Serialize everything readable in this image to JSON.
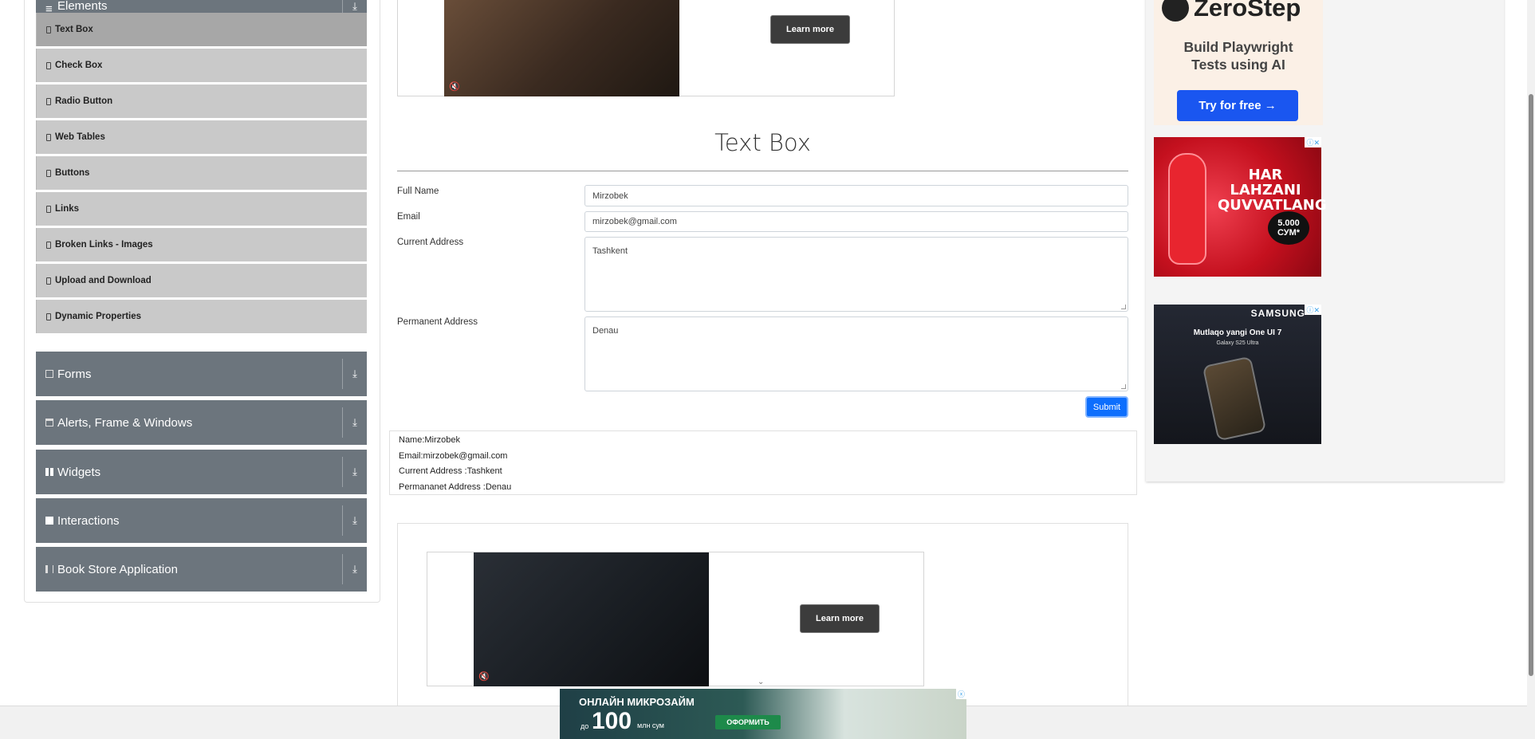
{
  "sidebar": {
    "elements_header": "Elements",
    "items": [
      {
        "label": "Text Box"
      },
      {
        "label": "Check Box"
      },
      {
        "label": "Radio Button"
      },
      {
        "label": "Web Tables"
      },
      {
        "label": "Buttons"
      },
      {
        "label": "Links"
      },
      {
        "label": "Broken Links - Images"
      },
      {
        "label": "Upload and Download"
      },
      {
        "label": "Dynamic Properties"
      }
    ],
    "groups": [
      {
        "label": "Forms",
        "icon": "form-icon"
      },
      {
        "label": "Alerts, Frame & Windows",
        "icon": "window-icon"
      },
      {
        "label": "Widgets",
        "icon": "widgets-icon"
      },
      {
        "label": "Interactions",
        "icon": "interactions-icon"
      },
      {
        "label": "Book Store Application",
        "icon": "book-icon"
      }
    ],
    "expand_arrow": "⤓"
  },
  "top_ad": {
    "button": "Learn more",
    "mute": "🔇"
  },
  "main": {
    "title": "Text Box",
    "fields": {
      "full_name_label": "Full Name",
      "full_name_value": "Mirzobek",
      "email_label": "Email",
      "email_value": "mirzobek@gmail.com",
      "current_address_label": "Current Address",
      "current_address_value": "Tashkent",
      "permanent_address_label": "Permanent Address",
      "permanent_address_value": "Denau"
    },
    "submit_label": "Submit",
    "output": {
      "name": "Name:Mirzobek",
      "email": "Email:mirzobek@gmail.com",
      "current_address": "Current Address :Tashkent",
      "permanent_address": "Permananet Address :Denau"
    }
  },
  "bottom_ad": {
    "button": "Learn more",
    "mute": "🔇",
    "chevron": "⌄"
  },
  "right_ads": {
    "zerostep": {
      "brand": "ZeroStep",
      "line1": "Build Playwright",
      "line2": "Tests using AI",
      "button": "Try for free →"
    },
    "red": {
      "line1": "HAR",
      "line2": "LAHZANI",
      "line3": "QUVVATLANG",
      "price": "5.000",
      "currency": "СУМ*"
    },
    "samsung": {
      "brand": "SAMSUNG",
      "line1": "Mutlaqo yangi One UI 7",
      "line2": "Galaxy S25 Ultra"
    }
  },
  "banner": {
    "title": "ОНЛАЙН МИКРОЗАЙМ",
    "prefix": "до",
    "amount": "100",
    "unit": "млн сум",
    "button": "ОФОРМИТЬ",
    "close": "ⓧ"
  },
  "colors": {
    "primary": "#0d6efd",
    "sidebar_group": "#6c757d",
    "menu_item": "#c9c9c9",
    "menu_active": "#a7a7a7"
  }
}
